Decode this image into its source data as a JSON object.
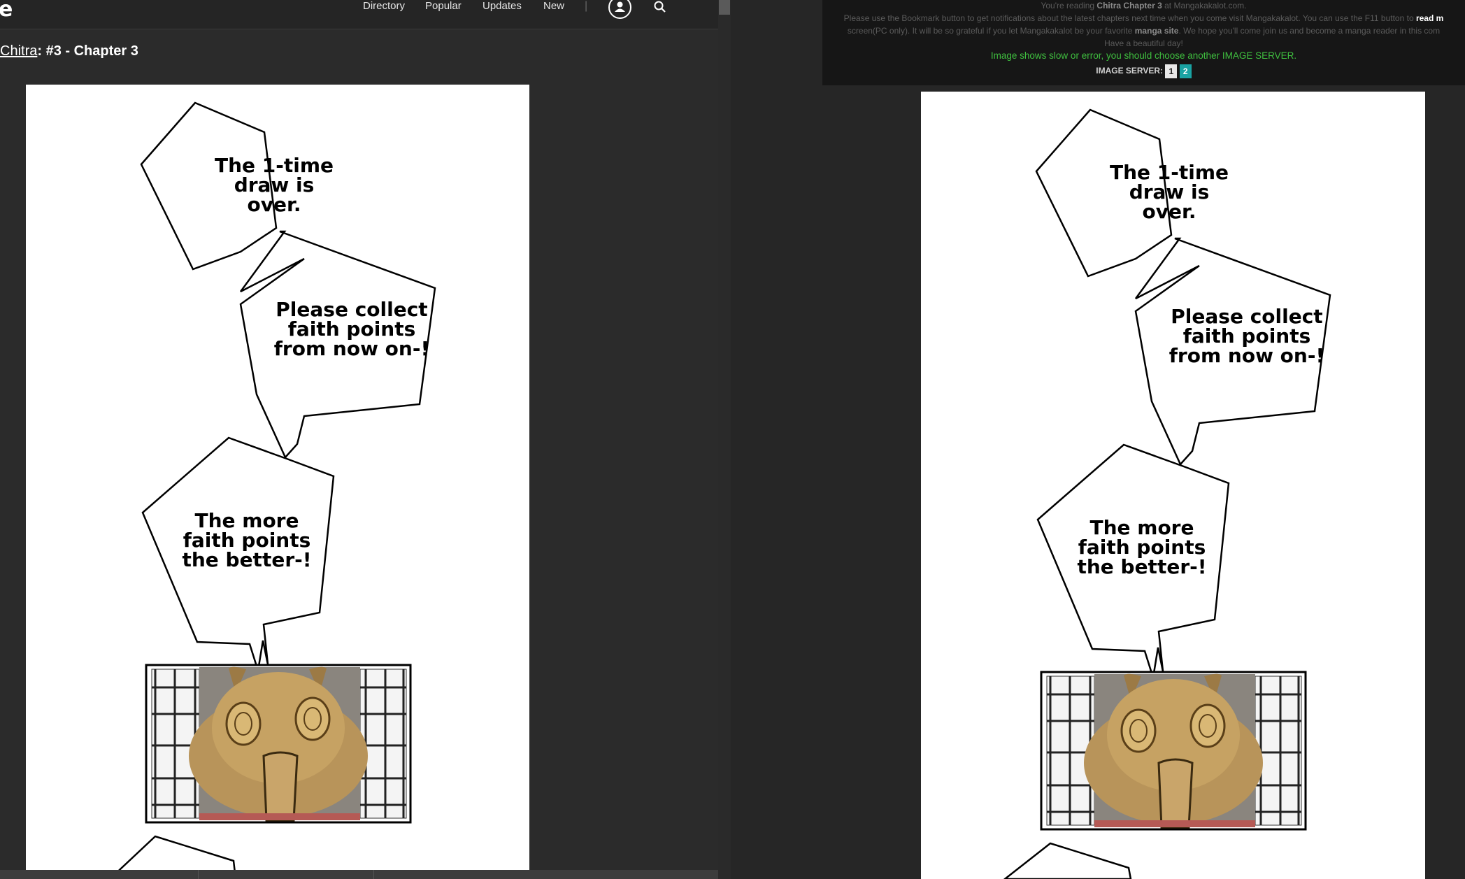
{
  "left_window": {
    "logo": "e",
    "nav": {
      "directory": "Directory",
      "popular": "Popular",
      "updates": "Updates",
      "new": "New",
      "separator": "|"
    },
    "icons": {
      "account": "user-icon",
      "search": "search-icon"
    },
    "breadcrumb": {
      "series": "Chitra",
      "chapter": ": #3 - Chapter 3"
    }
  },
  "right_window": {
    "notice": {
      "line1_pre": "You're reading ",
      "line1_bold": "Chitra Chapter 3",
      "line1_post": " at Mangakakalot.com.",
      "line2_pre": "Please use the Bookmark button to get notifications about the latest chapters next time when you come visit Mangakakalot. You can use the F11 button to ",
      "line2_bold": "read m",
      "line3_pre": "screen(PC only). It will be so grateful if you let Mangakakalot be your favorite ",
      "line3_bold": "manga site",
      "line3_post": ". We hope you'll come join us and become a manga reader in this com",
      "line4": "Have a beautiful day!",
      "slow_notice": "Image shows slow or error, you should choose another IMAGE SERVER.",
      "server_label": "IMAGE SERVER:",
      "server_1": "1",
      "server_2": "2"
    }
  },
  "manga_page": {
    "bubble1": [
      "The 1-time",
      "draw is",
      "over."
    ],
    "bubble2": [
      "Please collect",
      "faith points",
      "from now on-!"
    ],
    "bubble3": [
      "The more",
      "faith points",
      "the better-!"
    ]
  },
  "colors": {
    "green_notice": "#3fbf3f",
    "server_1_bg": "#e8e8e8",
    "server_2_bg": "#1aa3a3",
    "character": "#b8945a"
  }
}
